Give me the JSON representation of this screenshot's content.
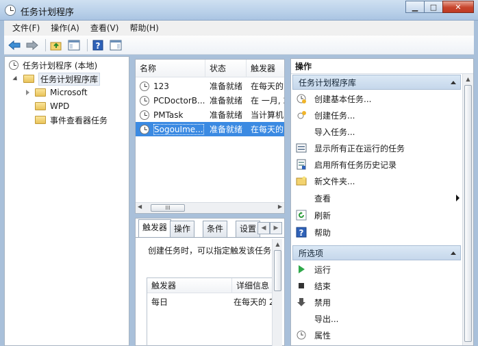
{
  "window": {
    "title": "任务计划程序",
    "min_icon": "minimize-icon",
    "max_icon": "maximize-icon",
    "close_icon": "close-icon"
  },
  "menu": {
    "items": [
      "文件(F)",
      "操作(A)",
      "查看(V)",
      "帮助(H)"
    ]
  },
  "toolbar": {
    "icons": [
      "back-icon",
      "forward-icon",
      "up-folder-icon",
      "show-hide-tree-icon",
      "help-icon",
      "show-hide-action-pane-icon"
    ]
  },
  "tree": {
    "root": "任务计划程序 (本地)",
    "library": "任务计划程序库",
    "children": [
      "Microsoft",
      "WPD",
      "事件查看器任务"
    ]
  },
  "tasks": {
    "columns": [
      "名称",
      "状态",
      "触发器"
    ],
    "rows": [
      {
        "name": "123",
        "status": "准备就绪",
        "trigger": "在每天的"
      },
      {
        "name": "PCDoctorB...",
        "status": "准备就绪",
        "trigger": "在 一月, 2"
      },
      {
        "name": "PMTask",
        "status": "准备就绪",
        "trigger": "当计算机"
      },
      {
        "name": "SogouIme...",
        "status": "准备就绪",
        "trigger": "在每天的"
      }
    ],
    "selected_index": 3,
    "hscroll_grip": "III"
  },
  "details": {
    "tabs": [
      "触发器",
      "操作",
      "条件",
      "设置"
    ],
    "active_tab": 0,
    "description": "创建任务时，可以指定触发该任务",
    "table": {
      "columns": [
        "触发器",
        "详细信息"
      ],
      "rows": [
        {
          "trigger": "每日",
          "detail": "在每天的 2"
        }
      ]
    }
  },
  "actions": {
    "header": "操作",
    "sections": [
      {
        "title": "任务计划程序库",
        "items": [
          {
            "label": "创建基本任务...",
            "icon": "create-basic-task-icon"
          },
          {
            "label": "创建任务...",
            "icon": "create-task-icon"
          },
          {
            "label": "导入任务...",
            "icon": ""
          },
          {
            "label": "显示所有正在运行的任务",
            "icon": "running-tasks-icon"
          },
          {
            "label": "启用所有任务历史记录",
            "icon": "history-icon"
          },
          {
            "label": "新文件夹...",
            "icon": "new-folder-icon"
          },
          {
            "label": "查看",
            "icon": ""
          },
          {
            "label": "刷新",
            "icon": "refresh-icon"
          },
          {
            "label": "帮助",
            "icon": "help-icon"
          }
        ]
      },
      {
        "title": "所选项",
        "items": [
          {
            "label": "运行",
            "icon": "run-icon"
          },
          {
            "label": "结束",
            "icon": "end-icon"
          },
          {
            "label": "禁用",
            "icon": "disable-icon"
          },
          {
            "label": "导出...",
            "icon": ""
          },
          {
            "label": "属性",
            "icon": "properties-icon"
          }
        ]
      }
    ]
  },
  "colors": {
    "selection": "#3b8ae2",
    "section_header": "#c5d7eb",
    "window_frame": "#a9c0da"
  }
}
